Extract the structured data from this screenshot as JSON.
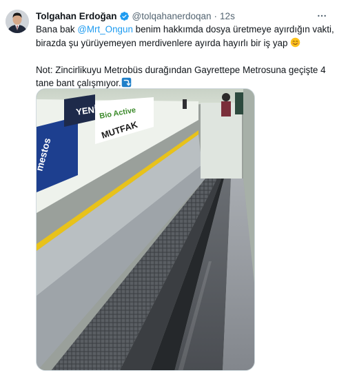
{
  "tweet": {
    "author": {
      "display_name": "Tolgahan Erdoğan",
      "handle": "@tolqahanerdoqan",
      "verified": true,
      "time": "12s",
      "separator": "·"
    },
    "text": {
      "line1_before": "Bana bak ",
      "mention": "@Mrt_Ongun",
      "line1_after": " benim hakkımda dosya üretmeye ayırdığın vakti,",
      "line2": "birazda şu yürüyemeyen merdivenlere ayırda hayırlı bir iş yap",
      "line3": "Not: Zincirlikuyu Metrobüs durağından Gayrettepe Metrosuna geçişte 4",
      "line4": "tane bant çalışmıyor."
    },
    "media": {
      "signs": {
        "sign1": "YENİ",
        "sign2": "Bio Active",
        "sign3": "MUTFAK",
        "sign4": "mestos"
      }
    },
    "icons": {
      "verified": "verified-badge-icon",
      "more": "more-options-icon",
      "emoji1": "smiling-face-emoji-icon",
      "emoji2": "right-arrow-curving-down-emoji-icon"
    },
    "colors": {
      "link": "#1d9bf0",
      "verified": "#1d9bf0",
      "secondary_text": "#536471",
      "primary_text": "#0f1419"
    }
  }
}
